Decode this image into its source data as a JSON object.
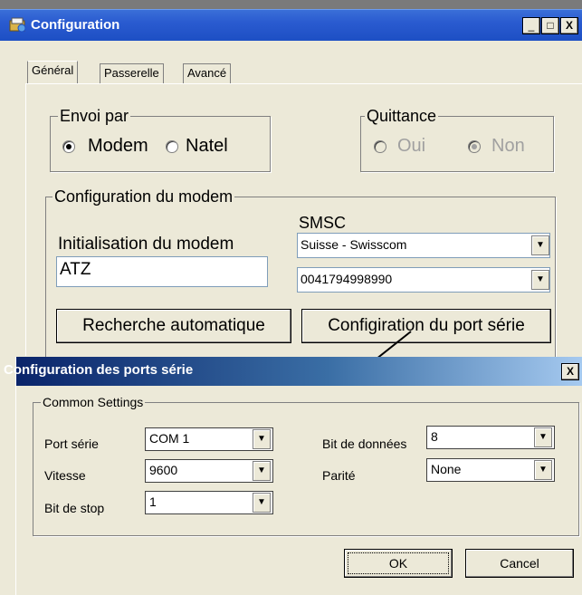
{
  "window": {
    "title": "Configuration",
    "buttons": {
      "minimize": "_",
      "maximize": "□",
      "close": "X"
    }
  },
  "tabs": [
    "Général",
    "Passerelle",
    "Avancé"
  ],
  "envoi_par": {
    "legend": "Envoi par",
    "options": [
      {
        "label": "Modem",
        "checked": true
      },
      {
        "label": "Natel",
        "checked": false
      }
    ]
  },
  "quittance": {
    "legend": "Quittance",
    "options": [
      {
        "label": "Oui",
        "checked": false,
        "disabled": true
      },
      {
        "label": "Non",
        "checked": true,
        "disabled": true
      }
    ]
  },
  "modem_config": {
    "legend": "Configuration du modem",
    "init_label": "Initialisation du modem",
    "init_value": "ATZ",
    "smsc_label": "SMSC",
    "smsc_provider": "Suisse - Swisscom",
    "smsc_number": "0041794998990",
    "search_button": "Recherche automatique",
    "port_button": "Configiration du port série"
  },
  "dialog": {
    "title": "Configuration des ports série",
    "close": "X",
    "group_legend": "Common Settings",
    "fields": {
      "port_label": "Port série",
      "port_value": "COM 1",
      "speed_label": "Vitesse",
      "speed_value": "9600",
      "stop_label": "Bit de stop",
      "stop_value": "1",
      "data_label": "Bit de données",
      "data_value": "8",
      "parity_label": "Parité",
      "parity_value": "None"
    },
    "ok_button": "OK",
    "cancel_button": "Cancel"
  },
  "colors": {
    "titlebar": "#2a5bd0",
    "dialog_title_start": "#0a246a",
    "dialog_title_end": "#a6caf0",
    "face": "#ece9d8"
  }
}
